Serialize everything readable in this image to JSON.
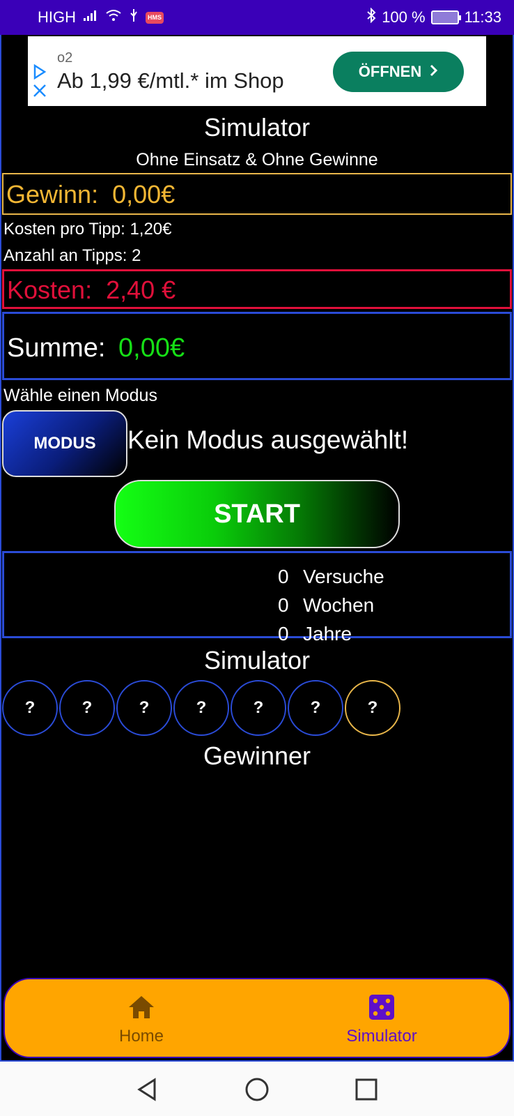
{
  "status_bar": {
    "network": "HIGH",
    "hms": "HMS",
    "battery": "100 %",
    "time": "11:33"
  },
  "ad": {
    "brand": "o2",
    "headline": "Ab 1,99 €/mtl.* im Shop",
    "button_label": "ÖFFNEN"
  },
  "header": {
    "title": "Simulator",
    "subtitle": "Ohne Einsatz & Ohne Gewinne"
  },
  "summary": {
    "gewinn_label": "Gewinn:",
    "gewinn_value": "0,00€",
    "kosten_pro_tipp": "Kosten pro Tipp: 1,20€",
    "anzahl_tipps": "Anzahl an Tipps: 2",
    "kosten_label": "Kosten:",
    "kosten_value": "2,40 €",
    "summe_label": "Summe:",
    "summe_value": "0,00€"
  },
  "mode": {
    "prompt": "Wähle einen Modus",
    "button_label": "MODUS",
    "status": "Kein Modus ausgewählt!"
  },
  "start_label": "START",
  "counters": [
    {
      "value": "0",
      "label": "Versuche"
    },
    {
      "value": "0",
      "label": "Wochen"
    },
    {
      "value": "0",
      "label": "Jahre"
    }
  ],
  "simulator": {
    "title": "Simulator",
    "balls": [
      "?",
      "?",
      "?",
      "?",
      "?",
      "?",
      "?"
    ],
    "winner_title": "Gewinner"
  },
  "bottom_nav": {
    "items": [
      {
        "label": "Home",
        "icon": "home-icon"
      },
      {
        "label": "Simulator",
        "icon": "dice-icon",
        "active": true
      }
    ]
  },
  "colors": {
    "status_bar": "#3A00B8",
    "gewinn": "#F2B634",
    "kosten": "#E0103A",
    "summe_value": "#16E016",
    "frame_blue": "#2A4BD6",
    "nav_bg": "#FFA500",
    "nav_active": "#5E0FC8",
    "ad_button": "#0A7F5F"
  }
}
